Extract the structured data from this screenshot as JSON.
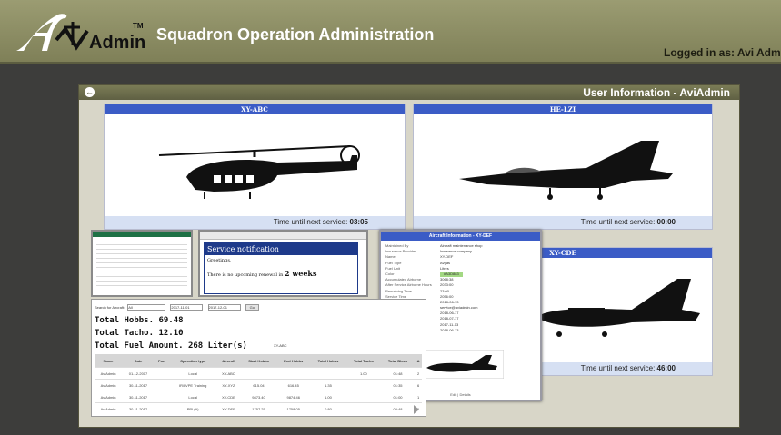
{
  "header": {
    "logo_text": "Admin",
    "logo_tm": "TM",
    "app_title": "Squadron Operation Administration",
    "logged_in": "Logged in as: Avi Admin"
  },
  "panel": {
    "title": "User Information - AviAdmin"
  },
  "aircraft": [
    {
      "registration": "XY-ABC",
      "service_label": "Time until next service:",
      "service_time": "03:05"
    },
    {
      "registration": "HE-LZI",
      "service_label": "Time until next service:",
      "service_time": "00:00"
    },
    {
      "registration": "XY-CDE",
      "service_label": "Time until next service:",
      "service_time": "46:00"
    }
  ],
  "notification": {
    "title": "Service notification",
    "greeting": "Greetings,",
    "message_prefix": "There is no upcoming renewal in",
    "message_highlight": "2 weeks"
  },
  "aircraft_info_popup": {
    "title": "Aircraft Information - XY-DEF",
    "rows": [
      {
        "key": "Maintained By",
        "value": "Aircraft maintenance shop"
      },
      {
        "key": "Insurance Provider",
        "value": "Insurance company"
      },
      {
        "key": "Name",
        "value": "XY-DEF"
      },
      {
        "key": "Fuel Type",
        "value": "Avgas"
      },
      {
        "key": "Fuel Unit",
        "value": "Litres"
      },
      {
        "key": "Color",
        "value": "#A3D883"
      },
      {
        "key": "Accumulated Airborne",
        "value": "3068:38"
      },
      {
        "key": "After Service Airborne Hours",
        "value": "2033:00"
      },
      {
        "key": "Remaining Time",
        "value": "23:00"
      },
      {
        "key": "Service Time",
        "value": "2056:00"
      },
      {
        "key": "Service Due Date",
        "value": "2018-06-13"
      },
      {
        "key": "Service Email",
        "value": "service@aviadmin.com"
      },
      {
        "key": "Insurance Expiry",
        "value": "2018-06-17"
      },
      {
        "key": "CofA",
        "value": "2018-07-17"
      },
      {
        "key": "First Aid Kit",
        "value": "2017-11-13"
      },
      {
        "key": "Fire Extinguisher",
        "value": "2018-06-13"
      }
    ],
    "footer_links": "Edit | Details"
  },
  "search": {
    "label": "Search for Aircraft:",
    "aircraft_value": "All",
    "date_from": "2017-11-01",
    "date_to": "2017-12-01",
    "go_label": "Go"
  },
  "totals": {
    "hobbs": "Total Hobbs. 69.48",
    "tacho": "Total Tacho. 12.10",
    "fuel": "Total Fuel Amount. 268 Liter(s)",
    "fuel_aircraft": "XY-ABC"
  },
  "table": {
    "headers": [
      "Name",
      "Date",
      "Fuel",
      "Operation type",
      "Aircraft",
      "Start Hobbs",
      "End Hobbs",
      "Total Hobbs",
      "Total Tacho",
      "Total Block",
      "A"
    ],
    "rows": [
      [
        "AviAdmin",
        "01-12-2017",
        "",
        "Local",
        "XY-ABC",
        "",
        "",
        "",
        "1.00",
        "01:48",
        "2"
      ],
      [
        "AviAdmin",
        "30-11-2017",
        "",
        "IR/LVPE Training",
        "XY-XYZ",
        "615.04",
        "616.45",
        "1.35",
        "",
        "01:35",
        "6"
      ],
      [
        "AviAdmin",
        "30-11-2017",
        "",
        "Local",
        "XY-CDE",
        "9873.40",
        "9874.46",
        "1.00",
        "",
        "01:00",
        "1"
      ],
      [
        "AviAdmin",
        "30-11-2017",
        "",
        "PPL(A)",
        "XY-DEF",
        "1757.25",
        "1758.05",
        "0.80",
        "",
        "00:48",
        "1"
      ]
    ]
  }
}
